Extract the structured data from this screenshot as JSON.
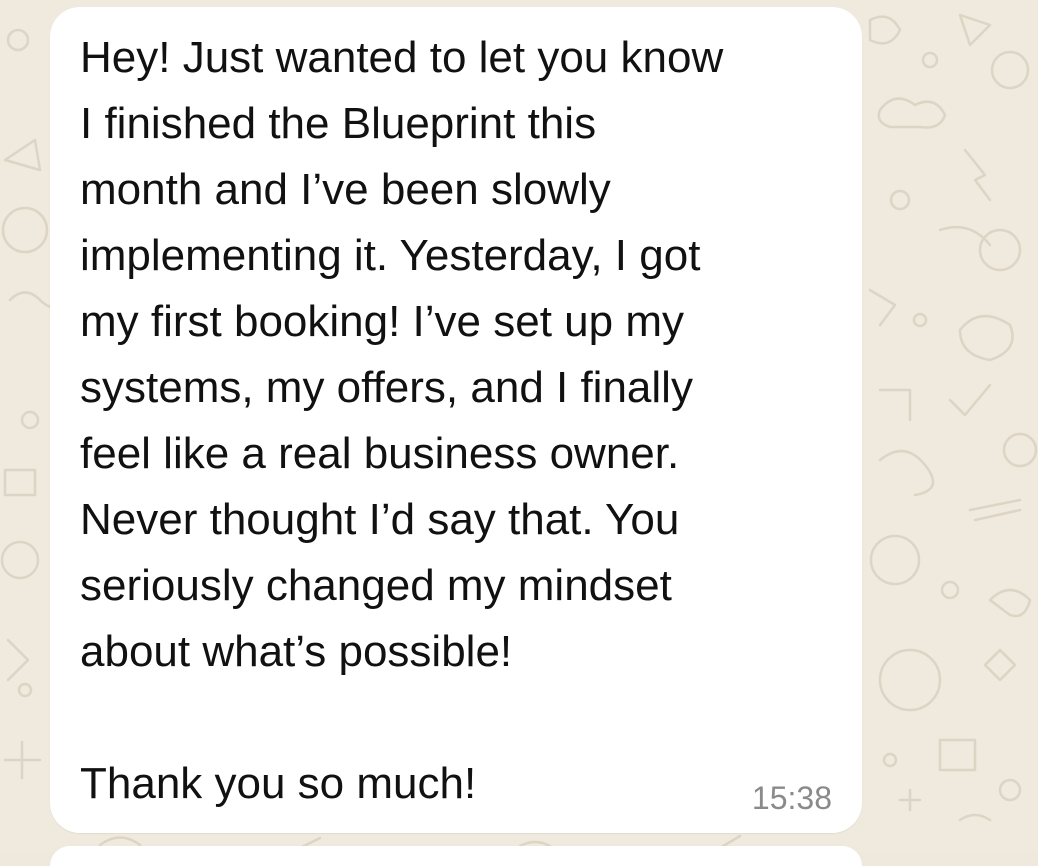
{
  "chat": {
    "message": {
      "text": "Hey! Just wanted to let you know\nI finished the Blueprint this\nmonth and I’ve been slowly\nimplementing it. Yesterday, I got\nmy first booking! I’ve set up my\nsystems, my offers, and I finally\nfeel like a real business owner.\nNever thought I’d say that. You\nseriously changed my mindset\nabout what’s possible!\n\nThank you so much!",
      "time": "15:38"
    }
  },
  "colors": {
    "wallpaper": "#efe9de",
    "bubble": "#ffffff",
    "text": "#111111",
    "timestamp": "#8a8a8a"
  }
}
